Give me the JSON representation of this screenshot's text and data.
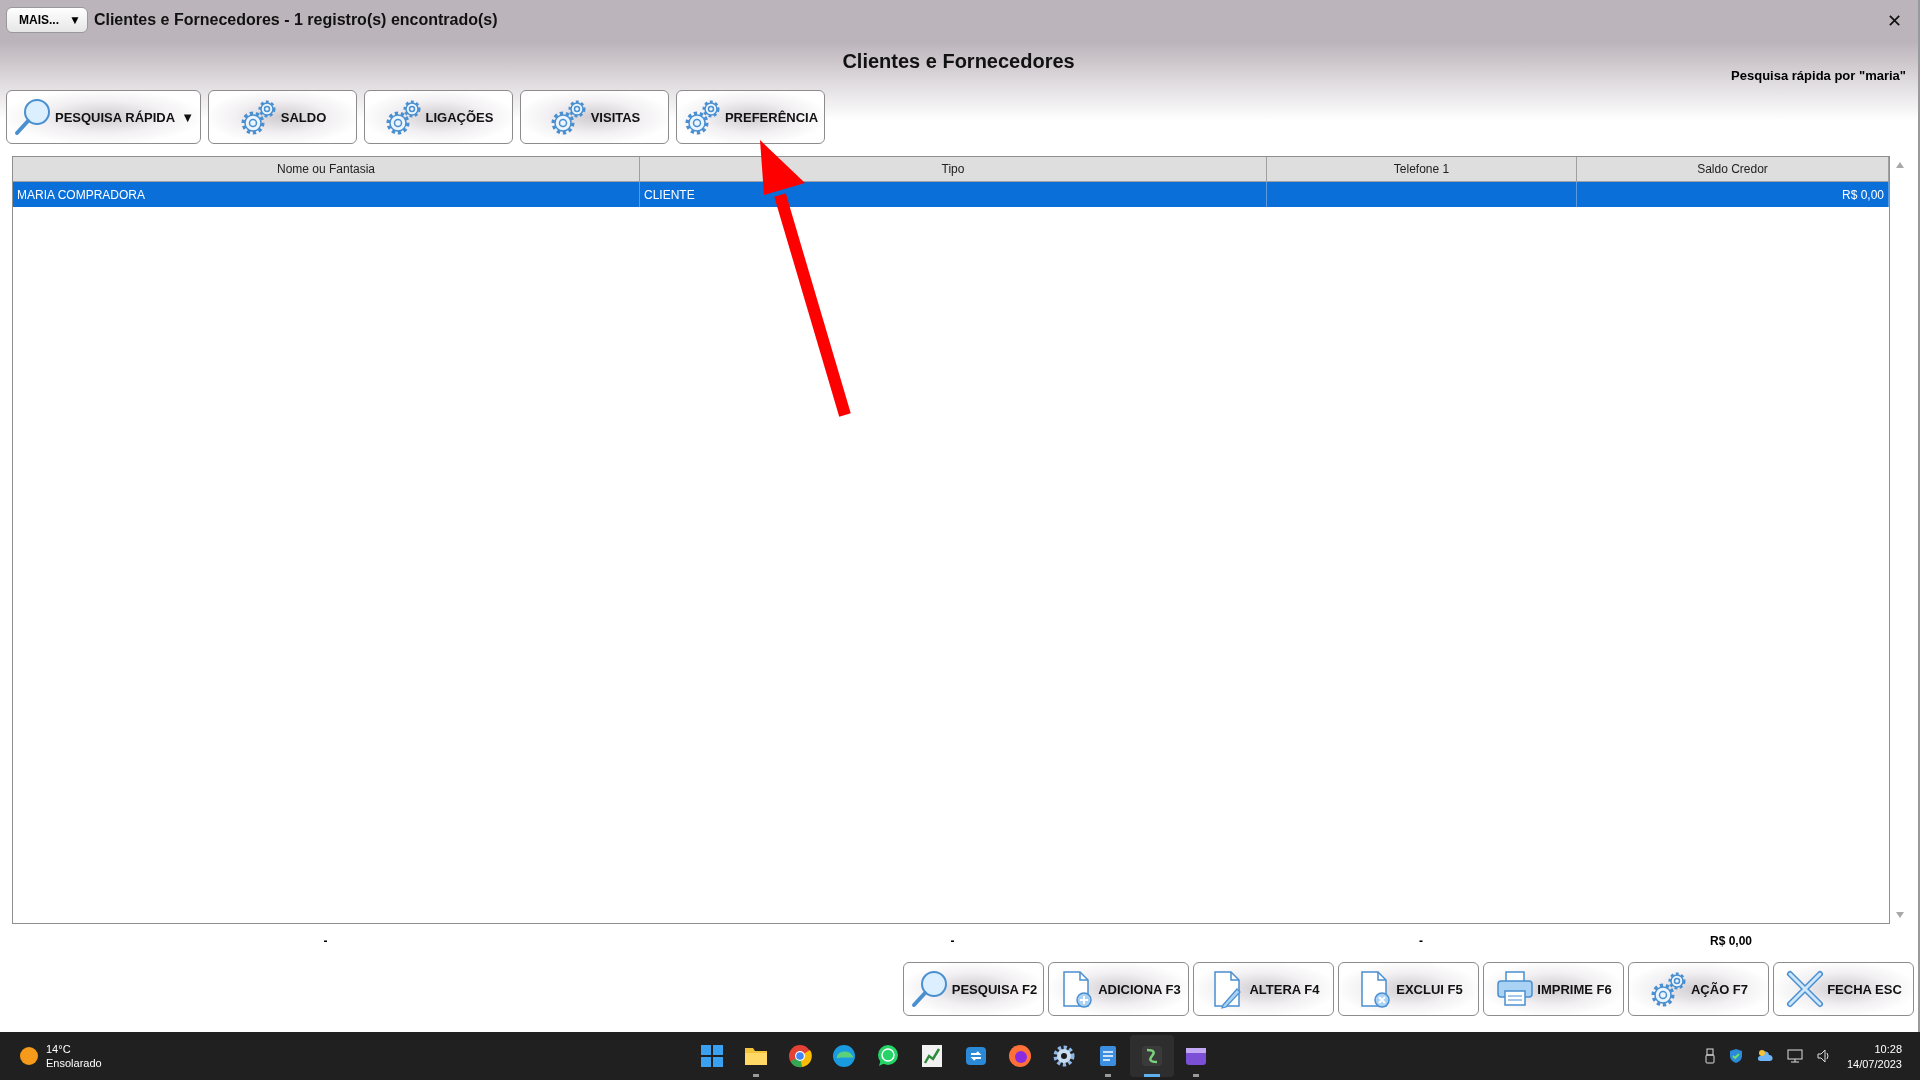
{
  "window": {
    "menu_button": "MAIS...",
    "menu_caret": "▼",
    "title": "Clientes e Fornecedores - 1 registro(s) encontrado(s)",
    "close": "✕"
  },
  "heading": "Clientes e Fornecedores",
  "search_note": "Pesquisa rápida por \"maria\"",
  "toolbar": [
    {
      "label": "PESQUISA RÁPIDA",
      "kind": "search",
      "caret": "▼"
    },
    {
      "label": "SALDO",
      "kind": "gears"
    },
    {
      "label": "LIGAÇÕES",
      "kind": "gears"
    },
    {
      "label": "VISITAS",
      "kind": "gears"
    },
    {
      "label": "PREFERÊNCIA",
      "kind": "gears"
    }
  ],
  "table": {
    "columns": [
      "Nome ou Fantasia",
      "Tipo",
      "Telefone 1",
      "Saldo Credor"
    ],
    "rows": [
      {
        "cells": [
          "MARIA COMPRADORA",
          "CLIENTE",
          null,
          "R$ 0,00"
        ],
        "selected": true
      }
    ]
  },
  "totals": [
    "-",
    "-",
    "-",
    "R$ 0,00"
  ],
  "actions": [
    {
      "label": "PESQUISA F2",
      "kind": "search"
    },
    {
      "label": "ADICIONA F3",
      "kind": "doc-add"
    },
    {
      "label": "ALTERA F4",
      "kind": "doc-edit"
    },
    {
      "label": "EXCLUI F5",
      "kind": "doc-remove"
    },
    {
      "label": "IMPRIME F6",
      "kind": "printer"
    },
    {
      "label": "AÇÃO F7",
      "kind": "gears"
    },
    {
      "label": "FECHA ESC",
      "kind": "cross"
    }
  ],
  "taskbar": {
    "weather": {
      "temperature": "14°C",
      "condition": "Ensolarado"
    },
    "apps": [
      {
        "kind": "start",
        "running": false,
        "active": false
      },
      {
        "kind": "folder",
        "running": true,
        "active": false
      },
      {
        "kind": "chrome",
        "running": false,
        "active": false
      },
      {
        "kind": "edge",
        "running": false,
        "active": false
      },
      {
        "kind": "chat",
        "running": false,
        "active": false
      },
      {
        "kind": "sheet",
        "running": false,
        "active": false
      },
      {
        "kind": "remote",
        "running": false,
        "active": false
      },
      {
        "kind": "firefox",
        "running": false,
        "active": false
      },
      {
        "kind": "gear",
        "running": false,
        "active": false
      },
      {
        "kind": "notepad",
        "running": true,
        "active": false
      },
      {
        "kind": "app",
        "running": true,
        "active": true
      },
      {
        "kind": "video",
        "running": true,
        "active": false
      }
    ],
    "clock": {
      "time": "10:28",
      "date": "14/07/2023"
    }
  }
}
